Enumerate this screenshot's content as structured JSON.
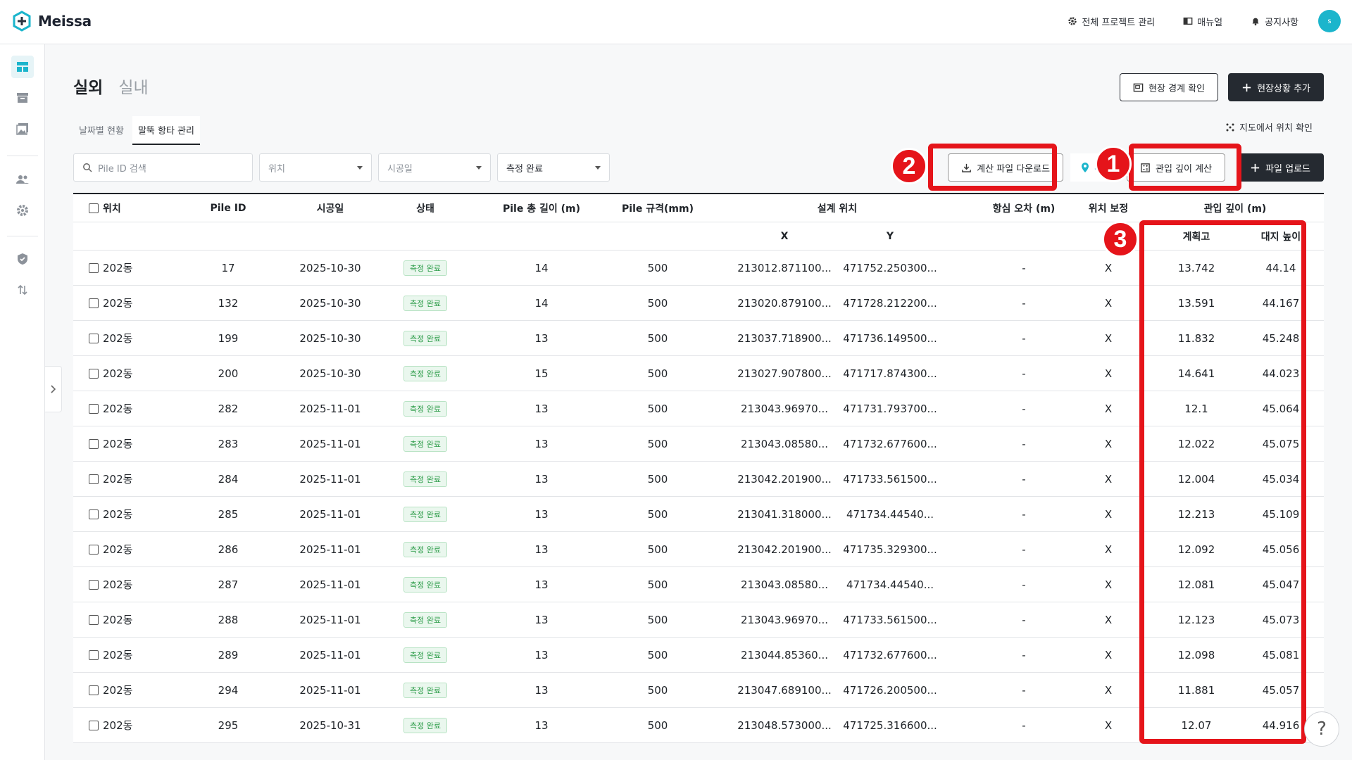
{
  "app": {
    "name": "Meissa",
    "avatar_initial": "s"
  },
  "topnav": [
    {
      "label": "전체 프로젝트 관리",
      "icon": "gear-icon"
    },
    {
      "label": "매뉴얼",
      "icon": "book-icon"
    },
    {
      "label": "공지사항",
      "icon": "bell-icon"
    }
  ],
  "page": {
    "tab_active": "실외",
    "tab_inactive": "실내",
    "btn_boundary": "현장 경계 확인",
    "btn_add_status": "현장상황 추가",
    "subtabs": [
      "날짜별 현황",
      "말뚝 항타 관리"
    ],
    "map_check": "지도에서 위치 확인"
  },
  "filters": {
    "search_placeholder": "Pile ID 검색",
    "location": "위치",
    "date": "시공일",
    "status": "측정 완료"
  },
  "actions": {
    "download": "계산 파일 다운로드",
    "location_short": "위",
    "calc_depth": "관입 깊이 계산",
    "upload": "파일 업로드"
  },
  "table": {
    "headers": {
      "location": "위치",
      "pile_id": "Pile ID",
      "date": "시공일",
      "status": "상태",
      "pile_length": "Pile 총 길이 (m)",
      "pile_spec": "Pile 규격(mm)",
      "design_pos": "설계 위치",
      "x": "X",
      "y": "Y",
      "error": "항심 오차 (m)",
      "pos_correct": "위치 보정",
      "depth": "관입 깊이 (m)",
      "plan_height": "계획고",
      "ground_height": "대지 높이"
    },
    "rows": [
      {
        "loc": "202동",
        "id": "17",
        "date": "2025-10-30",
        "status": "측정 완료",
        "len": "14",
        "spec": "500",
        "x": "213012.871100...",
        "y": "471752.250300...",
        "err": "-",
        "corr": "X",
        "plan": "13.742",
        "ground": "44.14"
      },
      {
        "loc": "202동",
        "id": "132",
        "date": "2025-10-30",
        "status": "측정 완료",
        "len": "14",
        "spec": "500",
        "x": "213020.879100...",
        "y": "471728.212200...",
        "err": "-",
        "corr": "X",
        "plan": "13.591",
        "ground": "44.167"
      },
      {
        "loc": "202동",
        "id": "199",
        "date": "2025-10-30",
        "status": "측정 완료",
        "len": "13",
        "spec": "500",
        "x": "213037.718900...",
        "y": "471736.149500...",
        "err": "-",
        "corr": "X",
        "plan": "11.832",
        "ground": "45.248"
      },
      {
        "loc": "202동",
        "id": "200",
        "date": "2025-10-30",
        "status": "측정 완료",
        "len": "15",
        "spec": "500",
        "x": "213027.907800...",
        "y": "471717.874300...",
        "err": "-",
        "corr": "X",
        "plan": "14.641",
        "ground": "44.023"
      },
      {
        "loc": "202동",
        "id": "282",
        "date": "2025-11-01",
        "status": "측정 완료",
        "len": "13",
        "spec": "500",
        "x": "213043.96970...",
        "y": "471731.793700...",
        "err": "-",
        "corr": "X",
        "plan": "12.1",
        "ground": "45.064"
      },
      {
        "loc": "202동",
        "id": "283",
        "date": "2025-11-01",
        "status": "측정 완료",
        "len": "13",
        "spec": "500",
        "x": "213043.08580...",
        "y": "471732.677600...",
        "err": "-",
        "corr": "X",
        "plan": "12.022",
        "ground": "45.075"
      },
      {
        "loc": "202동",
        "id": "284",
        "date": "2025-11-01",
        "status": "측정 완료",
        "len": "13",
        "spec": "500",
        "x": "213042.201900...",
        "y": "471733.561500...",
        "err": "-",
        "corr": "X",
        "plan": "12.004",
        "ground": "45.034"
      },
      {
        "loc": "202동",
        "id": "285",
        "date": "2025-11-01",
        "status": "측정 완료",
        "len": "13",
        "spec": "500",
        "x": "213041.318000...",
        "y": "471734.44540...",
        "err": "-",
        "corr": "X",
        "plan": "12.213",
        "ground": "45.109"
      },
      {
        "loc": "202동",
        "id": "286",
        "date": "2025-11-01",
        "status": "측정 완료",
        "len": "13",
        "spec": "500",
        "x": "213042.201900...",
        "y": "471735.329300...",
        "err": "-",
        "corr": "X",
        "plan": "12.092",
        "ground": "45.056"
      },
      {
        "loc": "202동",
        "id": "287",
        "date": "2025-11-01",
        "status": "측정 완료",
        "len": "13",
        "spec": "500",
        "x": "213043.08580...",
        "y": "471734.44540...",
        "err": "-",
        "corr": "X",
        "plan": "12.081",
        "ground": "45.047"
      },
      {
        "loc": "202동",
        "id": "288",
        "date": "2025-11-01",
        "status": "측정 완료",
        "len": "13",
        "spec": "500",
        "x": "213043.96970...",
        "y": "471733.561500...",
        "err": "-",
        "corr": "X",
        "plan": "12.123",
        "ground": "45.073"
      },
      {
        "loc": "202동",
        "id": "289",
        "date": "2025-11-01",
        "status": "측정 완료",
        "len": "13",
        "spec": "500",
        "x": "213044.85360...",
        "y": "471732.677600...",
        "err": "-",
        "corr": "X",
        "plan": "12.098",
        "ground": "45.081"
      },
      {
        "loc": "202동",
        "id": "294",
        "date": "2025-11-01",
        "status": "측정 완료",
        "len": "13",
        "spec": "500",
        "x": "213047.689100...",
        "y": "471726.200500...",
        "err": "-",
        "corr": "X",
        "plan": "11.881",
        "ground": "45.057"
      },
      {
        "loc": "202동",
        "id": "295",
        "date": "2025-10-31",
        "status": "측정 완료",
        "len": "13",
        "spec": "500",
        "x": "213048.573000...",
        "y": "471725.316600...",
        "err": "-",
        "corr": "X",
        "plan": "12.07",
        "ground": "44.916"
      }
    ]
  },
  "annotations": [
    "1",
    "2",
    "3"
  ],
  "help": "?",
  "colors": {
    "accent": "#1bb5cc",
    "annotation": "#e5141a",
    "dark_button": "#252a31",
    "badge_green": "#2e9d4a"
  }
}
